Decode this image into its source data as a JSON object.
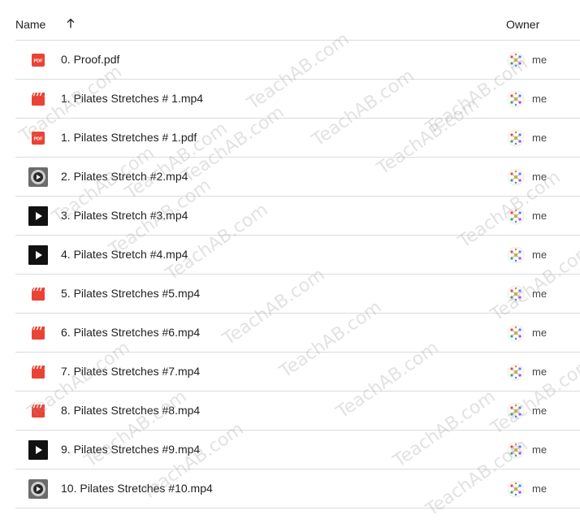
{
  "header": {
    "name_label": "Name",
    "sort_icon": "arrow-upward-icon",
    "owner_label": "Owner"
  },
  "files": [
    {
      "name": "0. Proof.pdf",
      "type": "pdf",
      "owner": "me"
    },
    {
      "name": "1. Pilates Stretches # 1.mp4",
      "type": "video-clapper",
      "owner": "me"
    },
    {
      "name": "1. Pilates Stretches # 1.pdf",
      "type": "pdf",
      "owner": "me"
    },
    {
      "name": "2. Pilates Stretch #2.mp4",
      "type": "video-thumb-round",
      "owner": "me"
    },
    {
      "name": "3. Pilates Stretch #3.mp4",
      "type": "video-thumb-play",
      "owner": "me"
    },
    {
      "name": "4. Pilates Stretch #4.mp4",
      "type": "video-thumb-play",
      "owner": "me"
    },
    {
      "name": "5. Pilates Stretches #5.mp4",
      "type": "video-clapper",
      "owner": "me"
    },
    {
      "name": "6. Pilates Stretches #6.mp4",
      "type": "video-clapper",
      "owner": "me"
    },
    {
      "name": "7. Pilates Stretches #7.mp4",
      "type": "video-clapper",
      "owner": "me"
    },
    {
      "name": "8. Pilates Stretches #8.mp4",
      "type": "video-clapper",
      "owner": "me"
    },
    {
      "name": "9. Pilates Stretches #9.mp4",
      "type": "video-thumb-play",
      "owner": "me"
    },
    {
      "name": "10. Pilates Stretches #10.mp4",
      "type": "video-thumb-round",
      "owner": "me"
    }
  ],
  "watermark_text": "TeachAB.com",
  "colors": {
    "pdf_red": "#ea4335",
    "video_red": "#ea4335",
    "divider": "#dadce0",
    "text": "#1f1f1f"
  }
}
